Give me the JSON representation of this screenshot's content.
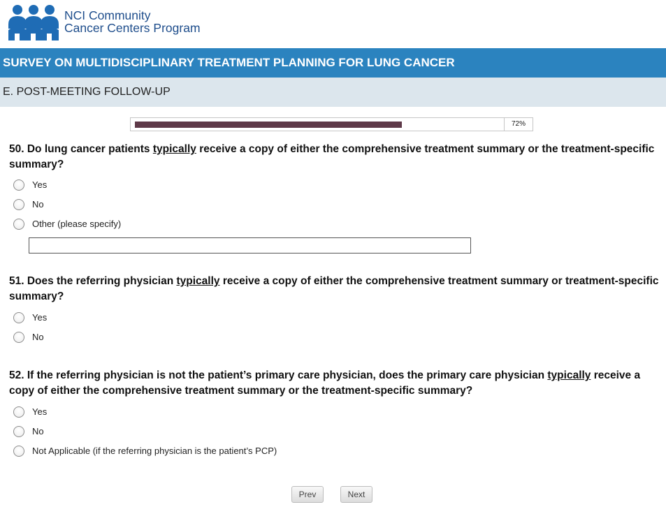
{
  "header": {
    "logo_line1": "NCI Community",
    "logo_line2": "Cancer Centers Program"
  },
  "survey": {
    "title": "SURVEY ON MULTIDISCIPLINARY TREATMENT PLANNING FOR LUNG CANCER",
    "section": "E. POST-MEETING FOLLOW-UP",
    "progress_label": "72%",
    "progress_fraction": 0.72
  },
  "questions": [
    {
      "before": "50. Do lung cancer patients ",
      "emphasis": "typically",
      "after": " receive a copy of either the comprehensive treatment summary or the treatment-specific summary?",
      "options": [
        "Yes",
        "No",
        "Other (please specify)"
      ],
      "other_value": ""
    },
    {
      "before": "51. Does the referring physician ",
      "emphasis": "typically",
      "after": " receive a copy of either the comprehensive treatment summary or treatment-specific summary?",
      "options": [
        "Yes",
        "No"
      ]
    },
    {
      "before": "52. If the referring physician is not the patient’s primary care physician, does the primary care physician ",
      "emphasis": "typically",
      "after": " receive a copy of either the comprehensive treatment summary or the treatment-specific summary?",
      "options": [
        "Yes",
        "No",
        "Not Applicable (if the referring physician is the patient’s PCP)"
      ]
    }
  ],
  "nav": {
    "prev_label": "Prev",
    "next_label": "Next"
  },
  "colors": {
    "title_bar": "#2b83bf",
    "section_bar": "#dce6ed",
    "progress_fill": "#5e3948",
    "logo_blue": "#1f6cb5"
  }
}
